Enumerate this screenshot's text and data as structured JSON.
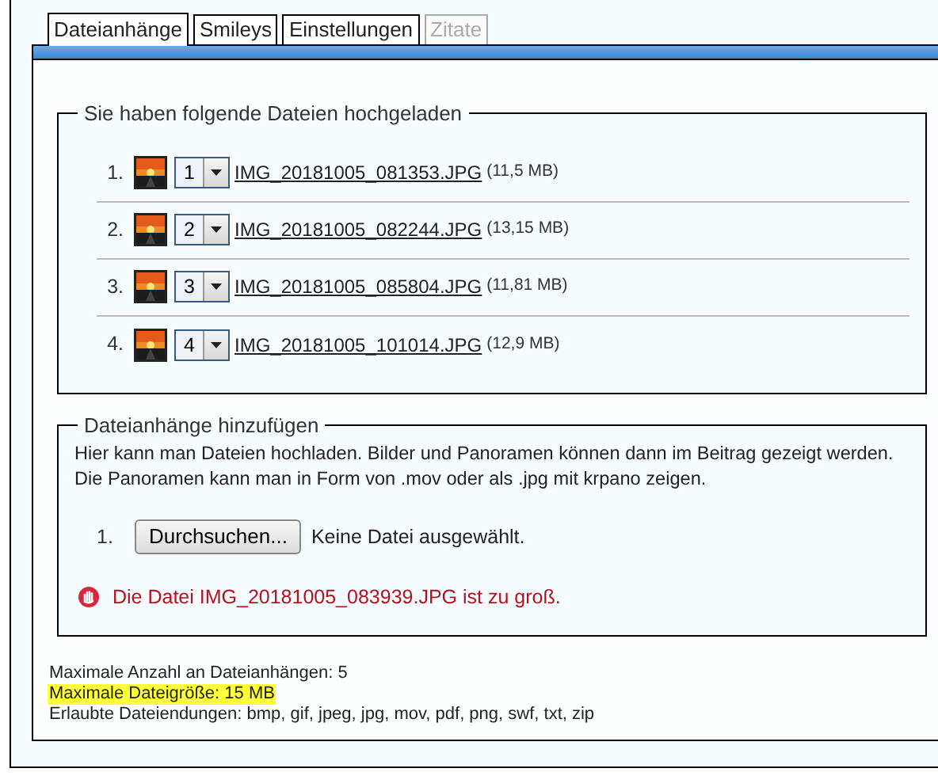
{
  "tabs": [
    {
      "label": "Dateianhänge",
      "selected": true,
      "disabled": false
    },
    {
      "label": "Smileys",
      "selected": false,
      "disabled": false
    },
    {
      "label": "Einstellungen",
      "selected": false,
      "disabled": false
    },
    {
      "label": "Zitate",
      "selected": false,
      "disabled": true
    }
  ],
  "uploaded": {
    "legend": "Sie haben folgende Dateien hochgeladen",
    "files": [
      {
        "index": "1.",
        "order": "1",
        "name": "IMG_20181005_081353.JPG",
        "size": "(11,5 MB)"
      },
      {
        "index": "2.",
        "order": "2",
        "name": "IMG_20181005_082244.JPG",
        "size": "(13,15 MB)"
      },
      {
        "index": "3.",
        "order": "3",
        "name": "IMG_20181005_085804.JPG",
        "size": "(11,81 MB)"
      },
      {
        "index": "4.",
        "order": "4",
        "name": "IMG_20181005_101014.JPG",
        "size": "(12,9 MB)"
      }
    ]
  },
  "add": {
    "legend": "Dateianhänge hinzufügen",
    "description": [
      "Hier kann man Dateien hochladen. Bilder und Panoramen können dann im Beitrag gezeigt werden.",
      "Die Panoramen kann man in Form von .mov oder als .jpg mit krpano zeigen."
    ],
    "slot": {
      "index": "1.",
      "button": "Durchsuchen...",
      "status": "Keine Datei ausgewählt."
    },
    "error": "Die Datei IMG_20181005_083939.JPG ist zu groß."
  },
  "limits": [
    {
      "text": "Maximale Anzahl an Dateianhängen: 5",
      "highlighted": false
    },
    {
      "text": "Maximale Dateigröße: 15 MB",
      "highlighted": true
    },
    {
      "text": "Erlaubte Dateiendungen: bmp, gif, jpeg, jpg, mov, pdf, png, swf, txt, zip",
      "highlighted": false
    }
  ]
}
